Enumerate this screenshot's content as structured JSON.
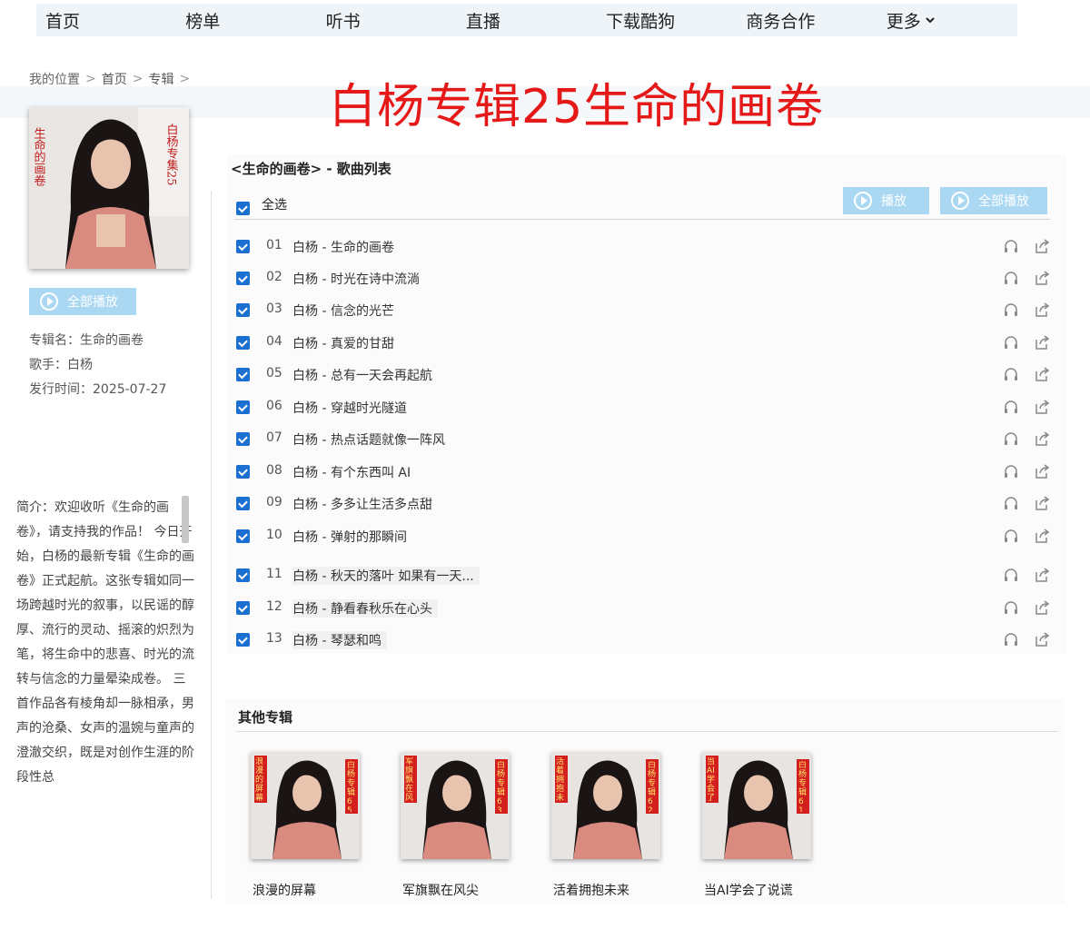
{
  "nav": [
    "首页",
    "榜单",
    "听书",
    "直播",
    "下载酷狗",
    "商务合作",
    "更多"
  ],
  "breadcrumb": {
    "label": "我的位置",
    "home": "首页",
    "section": "专辑"
  },
  "banner_title": "白杨专辑25生命的画卷",
  "cover": {
    "side_text": "生命的画卷",
    "tag_text": "白杨专集25"
  },
  "left_play_label": "全部播放",
  "album_info": {
    "name_label": "专辑名：",
    "name": "生命的画卷",
    "singer_label": "歌手：",
    "singer": "白杨",
    "date_label": "发行时间：",
    "date": "2025-07-27"
  },
  "intro": "简介：欢迎收听《生命的画卷》，请支持我的作品！ 今日开始，白杨的最新专辑《生命的画卷》正式起航。这张专辑如同一场跨越时光的叙事，以民谣的醇厚、流行的灵动、摇滚的炽烈为笔，将生命中的悲喜、时光的流转与信念的力量晕染成卷。 三首作品各有棱角却一脉相承，男声的沧桑、女声的温婉与童声的澄澈交织，既是对创作生涯的阶段性总",
  "list_title": "<生命的画卷> - 歌曲列表",
  "select_all": "全选",
  "play_button": "播放",
  "play_all_button": "全部播放",
  "songs": [
    {
      "num": "01",
      "title": "白杨 - 生命的画卷"
    },
    {
      "num": "02",
      "title": "白杨 - 时光在诗中流淌"
    },
    {
      "num": "03",
      "title": "白杨 - 信念的光芒"
    },
    {
      "num": "04",
      "title": "白杨 - 真爱的甘甜"
    },
    {
      "num": "05",
      "title": "白杨 - 总有一天会再起航"
    },
    {
      "num": "06",
      "title": "白杨 - 穿越时光隧道"
    },
    {
      "num": "07",
      "title": "白杨 - 热点话题就像一阵风"
    },
    {
      "num": "08",
      "title": "白杨 - 有个东西叫 AI"
    },
    {
      "num": "09",
      "title": "白杨 - 多多让生活多点甜"
    },
    {
      "num": "10",
      "title": "白杨 - 弹射的那瞬间"
    },
    {
      "num": "11",
      "title": "白杨 - 秋天的落叶 如果有一天..."
    },
    {
      "num": "12",
      "title": "白杨 - 静看春秋乐在心头"
    },
    {
      "num": "13",
      "title": "白杨 - 琴瑟和鸣"
    }
  ],
  "other_title": "其他专辑",
  "other_albums": [
    {
      "title": "浪漫的屏幕",
      "side": "浪漫的屏幕",
      "tag": "白杨专辑65"
    },
    {
      "title": "军旗飘在风尖",
      "side": "军旗飘在风尖",
      "tag": "白杨专辑63"
    },
    {
      "title": "活着拥抱未来",
      "side": "活着拥抱未来",
      "tag": "白杨专辑62"
    },
    {
      "title": "当AI学会了说谎",
      "side": "当AI学会了说谎",
      "tag": "白杨专辑61"
    }
  ]
}
